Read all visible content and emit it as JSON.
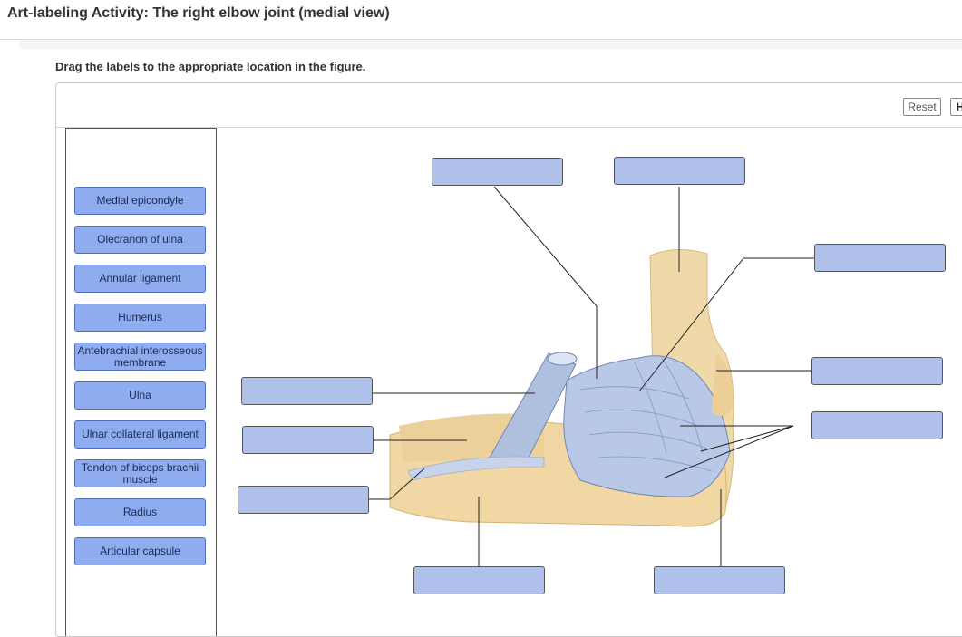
{
  "title": "Art-labeling Activity: The right elbow joint (medial view)",
  "instructions": "Drag the labels to the appropriate location in the figure.",
  "toolbar": {
    "reset_label": "Reset",
    "help_label": "H"
  },
  "labels": [
    "Medial epicondyle",
    "Olecranon of ulna",
    "Annular ligament",
    "Humerus",
    "Antebrachial interosseous membrane",
    "Ulna",
    "Ulnar collateral ligament",
    "Tendon of biceps brachii muscle",
    "Radius",
    "Articular capsule"
  ]
}
